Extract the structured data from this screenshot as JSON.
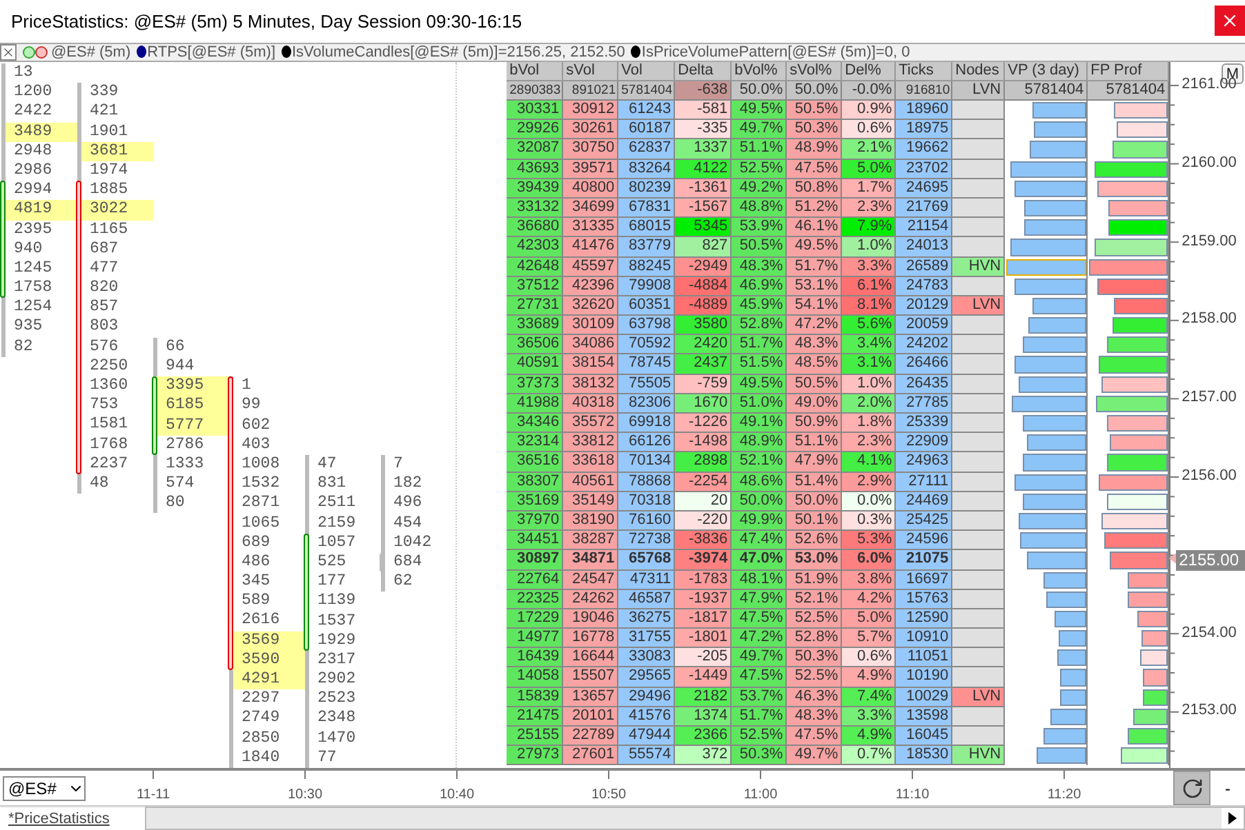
{
  "window": {
    "title": "PriceStatistics: @ES# (5m) 5 Minutes, Day Session 09:30-16:15"
  },
  "legend": {
    "items": [
      {
        "kind": "candles",
        "label": "@ES# (5m)"
      },
      {
        "kind": "dot",
        "color": "#00008b",
        "label": "RTPS[@ES# (5m)]"
      },
      {
        "kind": "dot",
        "color": "#000000",
        "label": "IsVolumeCandles[@ES# (5m)]=2156.25, 2152.50"
      },
      {
        "kind": "dot",
        "color": "#000000",
        "label": "IsPriceVolumePattern[@ES# (5m)]=0, 0"
      }
    ]
  },
  "footprint": {
    "candles": [
      {
        "kind": "bullish",
        "upper": [
          {
            "volume": "13",
            "highlighted": false
          },
          {
            "volume": "1200",
            "highlighted": false
          },
          {
            "volume": "2422",
            "highlighted": false
          },
          {
            "volume": "3489",
            "highlighted": true
          },
          {
            "volume": "2948",
            "highlighted": false
          },
          {
            "volume": "2986",
            "highlighted": false
          }
        ],
        "body": [
          {
            "volume": "2994",
            "highlighted": false
          },
          {
            "volume": "4819",
            "highlighted": true
          },
          {
            "volume": "2395",
            "highlighted": false
          },
          {
            "volume": "940",
            "highlighted": false
          },
          {
            "volume": "1245",
            "highlighted": false
          },
          {
            "volume": "1758",
            "highlighted": false
          }
        ],
        "lower": [
          {
            "volume": "1254",
            "highlighted": false
          },
          {
            "volume": "935",
            "highlighted": false
          },
          {
            "volume": "82",
            "highlighted": false
          }
        ]
      },
      {
        "kind": "bearish",
        "upper": [
          {
            "volume": "339",
            "highlighted": false
          },
          {
            "volume": "421",
            "highlighted": false
          },
          {
            "volume": "1901",
            "highlighted": false
          },
          {
            "volume": "3681",
            "highlighted": true
          },
          {
            "volume": "1974",
            "highlighted": false
          }
        ],
        "body": [
          {
            "volume": "1885",
            "highlighted": false
          },
          {
            "volume": "3022",
            "highlighted": true
          },
          {
            "volume": "1165",
            "highlighted": false
          },
          {
            "volume": "687",
            "highlighted": false
          },
          {
            "volume": "477",
            "highlighted": false
          },
          {
            "volume": "820",
            "highlighted": false
          },
          {
            "volume": "857",
            "highlighted": false
          },
          {
            "volume": "803",
            "highlighted": false
          },
          {
            "volume": "576",
            "highlighted": false
          },
          {
            "volume": "2250",
            "highlighted": false
          },
          {
            "volume": "1360",
            "highlighted": false
          },
          {
            "volume": "753",
            "highlighted": false
          },
          {
            "volume": "1581",
            "highlighted": false
          },
          {
            "volume": "1768",
            "highlighted": false
          },
          {
            "volume": "2237",
            "highlighted": false
          }
        ],
        "lower": [
          {
            "volume": "48",
            "highlighted": false
          }
        ]
      },
      {
        "kind": "bullish",
        "upper": [
          {
            "volume": "66",
            "highlighted": false
          },
          {
            "volume": "944",
            "highlighted": false
          }
        ],
        "body": [
          {
            "volume": "3395",
            "highlighted": true
          },
          {
            "volume": "6185",
            "highlighted": true
          },
          {
            "volume": "5777",
            "highlighted": true
          },
          {
            "volume": "2786",
            "highlighted": false
          }
        ],
        "lower": [
          {
            "volume": "1333",
            "highlighted": false
          },
          {
            "volume": "574",
            "highlighted": false
          },
          {
            "volume": "80",
            "highlighted": false
          }
        ]
      },
      {
        "kind": "bearish",
        "body": [
          {
            "volume": "1",
            "highlighted": false
          },
          {
            "volume": "99",
            "highlighted": false
          },
          {
            "volume": "602",
            "highlighted": false
          },
          {
            "volume": "403",
            "highlighted": false
          },
          {
            "volume": "1008",
            "highlighted": false
          },
          {
            "volume": "1532",
            "highlighted": false
          },
          {
            "volume": "2871",
            "highlighted": false
          },
          {
            "volume": "1065",
            "highlighted": false
          },
          {
            "volume": "689",
            "highlighted": false
          },
          {
            "volume": "486",
            "highlighted": false
          },
          {
            "volume": "345",
            "highlighted": false
          },
          {
            "volume": "589",
            "highlighted": false
          },
          {
            "volume": "2616",
            "highlighted": false
          },
          {
            "volume": "3569",
            "highlighted": true
          },
          {
            "volume": "3590",
            "highlighted": true
          }
        ],
        "lower": [
          {
            "volume": "4291",
            "highlighted": true
          },
          {
            "volume": "2297",
            "highlighted": false
          },
          {
            "volume": "2749",
            "highlighted": false
          },
          {
            "volume": "2850",
            "highlighted": false
          },
          {
            "volume": "1840",
            "highlighted": false
          }
        ]
      },
      {
        "kind": "bullish",
        "upper": [
          {
            "volume": "47",
            "highlighted": false
          },
          {
            "volume": "831",
            "highlighted": false
          },
          {
            "volume": "2511",
            "highlighted": false
          },
          {
            "volume": "2159",
            "highlighted": false
          }
        ],
        "body": [
          {
            "volume": "1057",
            "highlighted": false
          },
          {
            "volume": "525",
            "highlighted": false
          },
          {
            "volume": "177",
            "highlighted": false
          },
          {
            "volume": "1139",
            "highlighted": false
          },
          {
            "volume": "1537",
            "highlighted": false
          },
          {
            "volume": "1929",
            "highlighted": false
          }
        ],
        "lower": [
          {
            "volume": "2317",
            "highlighted": false
          },
          {
            "volume": "2902",
            "highlighted": false
          },
          {
            "volume": "2523",
            "highlighted": false
          },
          {
            "volume": "2348",
            "highlighted": false
          },
          {
            "volume": "1470",
            "highlighted": false
          },
          {
            "volume": "77",
            "highlighted": false
          }
        ]
      },
      {
        "kind": "neutral",
        "upper": [
          {
            "volume": "7",
            "highlighted": false
          },
          {
            "volume": "182",
            "highlighted": false
          },
          {
            "volume": "496",
            "highlighted": false
          },
          {
            "volume": "454",
            "highlighted": false
          },
          {
            "volume": "1042",
            "highlighted": false
          }
        ],
        "body": [
          {
            "volume": "684",
            "highlighted": false
          }
        ],
        "lower": [
          {
            "volume": "62",
            "highlighted": false
          }
        ]
      }
    ]
  },
  "table": {
    "columns": [
      "bVol",
      "sVol",
      "Vol",
      "Delta",
      "bVol%",
      "sVol%",
      "Del%",
      "Ticks",
      "Nodes",
      "VP (3 day)",
      "FP Prof"
    ],
    "totals": {
      "bvol": "2890383",
      "svol": "891021",
      "vol": "5781404",
      "delta": "-638",
      "color": "#c89595",
      "bvol_pct": "50.0%",
      "svol_pct": "50.0%",
      "del_pct": "-0.0%",
      "ticks": "916810",
      "node": "LVN",
      "vp": "5781404",
      "fp": "5781404"
    },
    "rows": [
      {
        "bvol": "30331",
        "svol": "30912",
        "vol": "61243",
        "delta": "-581",
        "bvol_pct": "49.5%",
        "svol_pct": "50.5%",
        "del_pct": "0.9%",
        "ticks": "18960",
        "color": "#ffd0d0",
        "current": false,
        "vp": {
          "level": 0.67,
          "outlined": false
        },
        "fp": {
          "level": 0.67
        }
      },
      {
        "bvol": "29926",
        "svol": "30261",
        "vol": "60187",
        "delta": "-335",
        "bvol_pct": "49.7%",
        "svol_pct": "50.3%",
        "del_pct": "0.6%",
        "ticks": "18975",
        "color": "#ffe0e0",
        "current": false,
        "vp": {
          "level": 0.65,
          "outlined": false
        },
        "fp": {
          "level": 0.64
        }
      },
      {
        "bvol": "32087",
        "svol": "30750",
        "vol": "62837",
        "delta": "1337",
        "bvol_pct": "51.1%",
        "svol_pct": "48.9%",
        "del_pct": "2.1%",
        "ticks": "19662",
        "color": "#80f080",
        "current": false,
        "vp": {
          "level": 0.69,
          "outlined": false
        },
        "fp": {
          "level": 0.69
        }
      },
      {
        "bvol": "43693",
        "svol": "39571",
        "vol": "83264",
        "delta": "4122",
        "bvol_pct": "52.5%",
        "svol_pct": "47.5%",
        "del_pct": "5.0%",
        "ticks": "23702",
        "color": "#33ee33",
        "current": false,
        "vp": {
          "level": 0.93,
          "outlined": false
        },
        "fp": {
          "level": 0.92
        }
      },
      {
        "bvol": "39439",
        "svol": "40800",
        "vol": "80239",
        "delta": "-1361",
        "bvol_pct": "49.2%",
        "svol_pct": "50.8%",
        "del_pct": "1.7%",
        "ticks": "24695",
        "color": "#ffb0b0",
        "current": false,
        "vp": {
          "level": 0.89,
          "outlined": false
        },
        "fp": {
          "level": 0.88
        }
      },
      {
        "bvol": "33132",
        "svol": "34699",
        "vol": "67831",
        "delta": "-1567",
        "bvol_pct": "48.8%",
        "svol_pct": "51.2%",
        "del_pct": "2.3%",
        "ticks": "21769",
        "color": "#ffaaaa",
        "current": false,
        "vp": {
          "level": 0.76,
          "outlined": false
        },
        "fp": {
          "level": 0.75
        }
      },
      {
        "bvol": "36680",
        "svol": "31335",
        "vol": "68015",
        "delta": "5345",
        "bvol_pct": "53.9%",
        "svol_pct": "46.1%",
        "del_pct": "7.9%",
        "ticks": "21154",
        "color": "#00ee00",
        "current": false,
        "vp": {
          "level": 0.76,
          "outlined": false
        },
        "fp": {
          "level": 0.75
        }
      },
      {
        "bvol": "42303",
        "svol": "41476",
        "vol": "83779",
        "delta": "827",
        "bvol_pct": "50.5%",
        "svol_pct": "49.5%",
        "del_pct": "1.0%",
        "ticks": "24013",
        "color": "#a0f0a0",
        "current": false,
        "vp": {
          "level": 0.93,
          "outlined": false
        },
        "fp": {
          "level": 0.92
        }
      },
      {
        "bvol": "42648",
        "svol": "45597",
        "vol": "88245",
        "delta": "-2949",
        "bvol_pct": "48.3%",
        "svol_pct": "51.7%",
        "del_pct": "3.3%",
        "ticks": "26589",
        "node": {
          "label": "HVN",
          "kind": "high"
        },
        "color": "#ff9090",
        "current": false,
        "vp": {
          "level": 0.99,
          "outlined": true
        },
        "fp": {
          "level": 0.98
        }
      },
      {
        "bvol": "37512",
        "svol": "42396",
        "vol": "79908",
        "delta": "-4884",
        "bvol_pct": "46.9%",
        "svol_pct": "53.1%",
        "del_pct": "6.1%",
        "ticks": "24783",
        "color": "#ff7070",
        "current": false,
        "vp": {
          "level": 0.89,
          "outlined": false
        },
        "fp": {
          "level": 0.88
        }
      },
      {
        "bvol": "27731",
        "svol": "32620",
        "vol": "60351",
        "delta": "-4889",
        "bvol_pct": "45.9%",
        "svol_pct": "54.1%",
        "del_pct": "8.1%",
        "ticks": "20129",
        "node": {
          "label": "LVN",
          "kind": "low"
        },
        "color": "#ff7070",
        "current": false,
        "vp": {
          "level": 0.67,
          "outlined": false
        },
        "fp": {
          "level": 0.67
        }
      },
      {
        "bvol": "33689",
        "svol": "30109",
        "vol": "63798",
        "delta": "3580",
        "bvol_pct": "52.8%",
        "svol_pct": "47.2%",
        "del_pct": "5.6%",
        "ticks": "20059",
        "color": "#33ee33",
        "current": false,
        "vp": {
          "level": 0.71,
          "outlined": false
        },
        "fp": {
          "level": 0.7
        }
      },
      {
        "bvol": "36506",
        "svol": "34086",
        "vol": "70592",
        "delta": "2420",
        "bvol_pct": "51.7%",
        "svol_pct": "48.3%",
        "del_pct": "3.4%",
        "ticks": "24202",
        "color": "#55ee55",
        "current": false,
        "vp": {
          "level": 0.78,
          "outlined": false
        },
        "fp": {
          "level": 0.76
        }
      },
      {
        "bvol": "40591",
        "svol": "38154",
        "vol": "78745",
        "delta": "2437",
        "bvol_pct": "51.5%",
        "svol_pct": "48.5%",
        "del_pct": "3.1%",
        "ticks": "26466",
        "color": "#44ee44",
        "current": false,
        "vp": {
          "level": 0.88,
          "outlined": false
        },
        "fp": {
          "level": 0.86
        }
      },
      {
        "bvol": "37373",
        "svol": "38132",
        "vol": "75505",
        "delta": "-759",
        "bvol_pct": "49.5%",
        "svol_pct": "50.5%",
        "del_pct": "1.0%",
        "ticks": "26435",
        "color": "#ffc0c0",
        "current": false,
        "vp": {
          "level": 0.84,
          "outlined": false
        },
        "fp": {
          "level": 0.83
        }
      },
      {
        "bvol": "41988",
        "svol": "40318",
        "vol": "82306",
        "delta": "1670",
        "bvol_pct": "51.0%",
        "svol_pct": "49.0%",
        "del_pct": "2.0%",
        "ticks": "27785",
        "color": "#77ee77",
        "current": false,
        "vp": {
          "level": 0.92,
          "outlined": false
        },
        "fp": {
          "level": 0.9
        }
      },
      {
        "bvol": "34346",
        "svol": "35572",
        "vol": "69918",
        "delta": "-1226",
        "bvol_pct": "49.1%",
        "svol_pct": "50.9%",
        "del_pct": "1.8%",
        "ticks": "25339",
        "color": "#ffb0b0",
        "current": false,
        "vp": {
          "level": 0.78,
          "outlined": false
        },
        "fp": {
          "level": 0.76
        }
      },
      {
        "bvol": "32314",
        "svol": "33812",
        "vol": "66126",
        "delta": "-1498",
        "bvol_pct": "48.9%",
        "svol_pct": "51.1%",
        "del_pct": "2.3%",
        "ticks": "22909",
        "color": "#ffa8a8",
        "current": false,
        "vp": {
          "level": 0.73,
          "outlined": false
        },
        "fp": {
          "level": 0.72
        }
      },
      {
        "bvol": "36516",
        "svol": "33618",
        "vol": "70134",
        "delta": "2898",
        "bvol_pct": "52.1%",
        "svol_pct": "47.9%",
        "del_pct": "4.1%",
        "ticks": "24963",
        "color": "#44ee44",
        "current": false,
        "vp": {
          "level": 0.78,
          "outlined": false
        },
        "fp": {
          "level": 0.76
        }
      },
      {
        "bvol": "38307",
        "svol": "40561",
        "vol": "78868",
        "delta": "-2254",
        "bvol_pct": "48.6%",
        "svol_pct": "51.4%",
        "del_pct": "2.9%",
        "ticks": "27111",
        "color": "#ff9a9a",
        "current": false,
        "vp": {
          "level": 0.88,
          "outlined": false
        },
        "fp": {
          "level": 0.86
        }
      },
      {
        "bvol": "35169",
        "svol": "35149",
        "vol": "70318",
        "delta": "20",
        "bvol_pct": "50.0%",
        "svol_pct": "50.0%",
        "del_pct": "0.0%",
        "ticks": "24469",
        "color": "#f0fff0",
        "current": false,
        "vp": {
          "level": 0.78,
          "outlined": false
        },
        "fp": {
          "level": 0.76
        }
      },
      {
        "bvol": "37970",
        "svol": "38190",
        "vol": "76160",
        "delta": "-220",
        "bvol_pct": "49.9%",
        "svol_pct": "50.1%",
        "del_pct": "0.3%",
        "ticks": "25425",
        "color": "#ffe0e0",
        "current": false,
        "vp": {
          "level": 0.84,
          "outlined": false
        },
        "fp": {
          "level": 0.83
        }
      },
      {
        "bvol": "34451",
        "svol": "38287",
        "vol": "72738",
        "delta": "-3836",
        "bvol_pct": "47.4%",
        "svol_pct": "52.6%",
        "del_pct": "5.3%",
        "ticks": "24596",
        "color": "#ff7a7a",
        "current": false,
        "vp": {
          "level": 0.81,
          "outlined": false
        },
        "fp": {
          "level": 0.8
        }
      },
      {
        "bvol": "30897",
        "svol": "34871",
        "vol": "65768",
        "delta": "-3974",
        "bvol_pct": "47.0%",
        "svol_pct": "53.0%",
        "del_pct": "6.0%",
        "ticks": "21075",
        "color": "#ff8080",
        "current": true,
        "vp": {
          "level": 0.73,
          "outlined": false
        },
        "fp": {
          "level": 0.72
        }
      },
      {
        "bvol": "22764",
        "svol": "24547",
        "vol": "47311",
        "delta": "-1783",
        "bvol_pct": "48.1%",
        "svol_pct": "51.9%",
        "del_pct": "3.8%",
        "ticks": "16697",
        "color": "#ff9a9a",
        "current": false,
        "vp": {
          "level": 0.52,
          "outlined": false
        },
        "fp": {
          "level": 0.51
        }
      },
      {
        "bvol": "22325",
        "svol": "24262",
        "vol": "46587",
        "delta": "-1937",
        "bvol_pct": "47.9%",
        "svol_pct": "52.1%",
        "del_pct": "4.2%",
        "ticks": "15763",
        "color": "#ffa0a0",
        "current": false,
        "vp": {
          "level": 0.5,
          "outlined": false
        },
        "fp": {
          "level": 0.5
        }
      },
      {
        "bvol": "17229",
        "svol": "19046",
        "vol": "36275",
        "delta": "-1817",
        "bvol_pct": "47.5%",
        "svol_pct": "52.5%",
        "del_pct": "5.0%",
        "ticks": "12590",
        "color": "#ffa0a0",
        "current": false,
        "vp": {
          "level": 0.39,
          "outlined": false
        },
        "fp": {
          "level": 0.38
        }
      },
      {
        "bvol": "14977",
        "svol": "16778",
        "vol": "31755",
        "delta": "-1801",
        "bvol_pct": "47.2%",
        "svol_pct": "52.8%",
        "del_pct": "5.7%",
        "ticks": "10910",
        "color": "#ffa8a8",
        "current": false,
        "vp": {
          "level": 0.34,
          "outlined": false
        },
        "fp": {
          "level": 0.33
        }
      },
      {
        "bvol": "16439",
        "svol": "16644",
        "vol": "33083",
        "delta": "-205",
        "bvol_pct": "49.7%",
        "svol_pct": "50.3%",
        "del_pct": "0.6%",
        "ticks": "11051",
        "color": "#ffe0e0",
        "current": false,
        "vp": {
          "level": 0.35,
          "outlined": false
        },
        "fp": {
          "level": 0.35
        }
      },
      {
        "bvol": "14058",
        "svol": "15507",
        "vol": "29565",
        "delta": "-1449",
        "bvol_pct": "47.5%",
        "svol_pct": "52.5%",
        "del_pct": "4.9%",
        "ticks": "10190",
        "color": "#ffa8a8",
        "current": false,
        "vp": {
          "level": 0.32,
          "outlined": false
        },
        "fp": {
          "level": 0.31
        }
      },
      {
        "bvol": "15839",
        "svol": "13657",
        "vol": "29496",
        "delta": "2182",
        "bvol_pct": "53.7%",
        "svol_pct": "46.3%",
        "del_pct": "7.4%",
        "ticks": "10029",
        "node": {
          "label": "LVN",
          "kind": "low"
        },
        "color": "#55ee55",
        "current": false,
        "vp": {
          "level": 0.32,
          "outlined": false
        },
        "fp": {
          "level": 0.31
        }
      },
      {
        "bvol": "21475",
        "svol": "20101",
        "vol": "41576",
        "delta": "1374",
        "bvol_pct": "51.7%",
        "svol_pct": "48.3%",
        "del_pct": "3.3%",
        "ticks": "13598",
        "color": "#77ee77",
        "current": false,
        "vp": {
          "level": 0.45,
          "outlined": false
        },
        "fp": {
          "level": 0.44
        }
      },
      {
        "bvol": "25155",
        "svol": "22789",
        "vol": "47944",
        "delta": "2366",
        "bvol_pct": "52.5%",
        "svol_pct": "47.5%",
        "del_pct": "4.9%",
        "ticks": "16045",
        "color": "#55ee55",
        "current": false,
        "vp": {
          "level": 0.52,
          "outlined": false
        },
        "fp": {
          "level": 0.51
        }
      },
      {
        "bvol": "27973",
        "svol": "27601",
        "vol": "55574",
        "delta": "372",
        "bvol_pct": "50.3%",
        "svol_pct": "49.7%",
        "del_pct": "0.7%",
        "ticks": "18530",
        "node": {
          "label": "HVN",
          "kind": "high"
        },
        "color": "#bbffbb",
        "current": false,
        "vp": {
          "level": 0.61,
          "outlined": false
        },
        "fp": {
          "level": 0.59
        }
      }
    ]
  },
  "price_axis": {
    "button": "M",
    "labels": [
      "2161.00",
      "2160.00",
      "2159.00",
      "2158.00",
      "2157.00",
      "2156.00",
      "2154.00",
      "2153.00"
    ],
    "current_price": "2155.00"
  },
  "time_axis": {
    "symbol": "@ES#",
    "labels": [
      "11-11",
      "10:30",
      "10:40",
      "10:50",
      "11:00",
      "11:10",
      "11:20"
    ],
    "minus_button": "-"
  },
  "tabs": [
    {
      "label": "*PriceStatistics",
      "selected": true
    }
  ]
}
